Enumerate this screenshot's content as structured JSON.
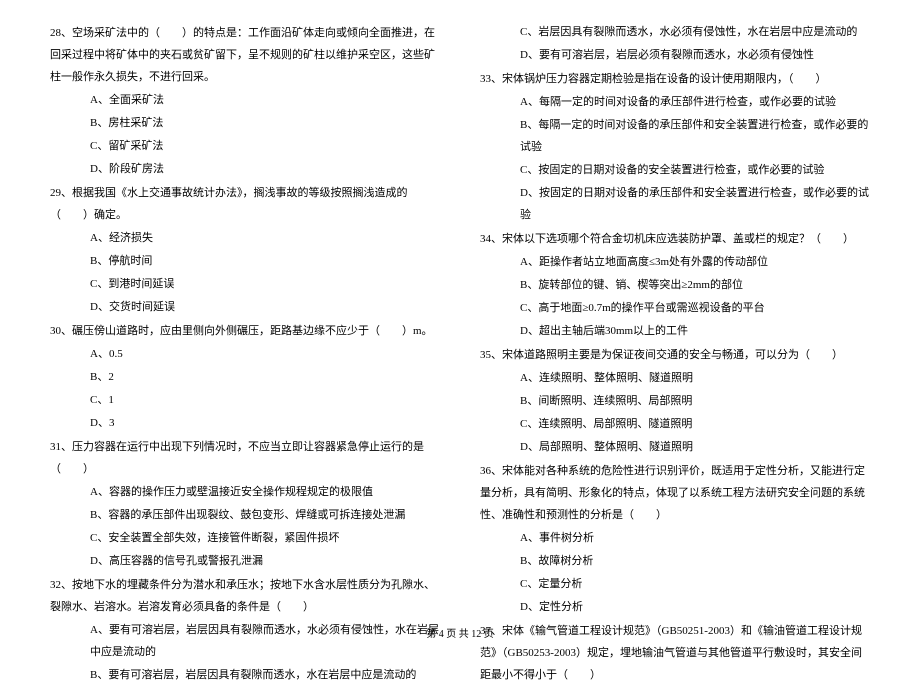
{
  "left_column": {
    "q28": {
      "text": "28、空场采矿法中的（　　）的特点是：工作面沿矿体走向或倾向全面推进，在回采过程中将矿体中的夹石或贫矿留下，呈不规则的矿柱以维护采空区，这些矿柱一般作永久损失，不进行回采。",
      "opts": [
        "A、全面采矿法",
        "B、房柱采矿法",
        "C、留矿采矿法",
        "D、阶段矿房法"
      ]
    },
    "q29": {
      "text": "29、根据我国《水上交通事故统计办法》，搁浅事故的等级按照搁浅造成的（　　）确定。",
      "opts": [
        "A、经济损失",
        "B、停航时间",
        "C、到港时间延误",
        "D、交货时间延误"
      ]
    },
    "q30": {
      "text": "30、碾压傍山道路时，应由里侧向外侧碾压，距路基边缘不应少于（　　）m。",
      "opts": [
        "A、0.5",
        "B、2",
        "C、1",
        "D、3"
      ]
    },
    "q31": {
      "text": "31、压力容器在运行中出现下列情况时，不应当立即让容器紧急停止运行的是（　　）",
      "opts": [
        "A、容器的操作压力或壁温接近安全操作规程规定的极限值",
        "B、容器的承压部件出现裂纹、鼓包变形、焊缝或可拆连接处泄漏",
        "C、安全装置全部失效，连接管件断裂，紧固件损坏",
        "D、高压容器的信号孔或警报孔泄漏"
      ]
    },
    "q32": {
      "text": "32、按地下水的埋藏条件分为潜水和承压水；按地下水含水层性质分为孔隙水、裂隙水、岩溶水。岩溶发育必须具备的条件是（　　）",
      "opts": [
        "A、要有可溶岩层，岩层因具有裂隙而透水，水必须有侵蚀性，水在岩层中应是流动的",
        "B、要有可溶岩层，岩层因具有裂隙而透水，水在岩层中应是流动的"
      ]
    }
  },
  "right_column": {
    "q32_cont": {
      "opts": [
        "C、岩层因具有裂隙而透水，水必须有侵蚀性，水在岩层中应是流动的",
        "D、要有可溶岩层，岩层必须有裂隙而透水，水必须有侵蚀性"
      ]
    },
    "q33": {
      "text": "33、宋体锅炉压力容器定期检验是指在设备的设计使用期限内，（　　）",
      "opts": [
        "A、每隔一定的时间对设备的承压部件进行检查，或作必要的试验",
        "B、每隔一定的时间对设备的承压部件和安全装置进行检查，或作必要的试验",
        "C、按固定的日期对设备的安全装置进行检查，或作必要的试验",
        "D、按固定的日期对设备的承压部件和安全装置进行检查，或作必要的试验"
      ]
    },
    "q34": {
      "text": "34、宋体以下选项哪个符合金切机床应选装防护罩、盖或栏的规定？（　　）",
      "opts": [
        "A、距操作者站立地面高度≤3m处有外露的传动部位",
        "B、旋转部位的键、销、楔等突出≥2mm的部位",
        "C、高于地面≥0.7m的操作平台或需巡视设备的平台",
        "D、超出主轴后端30mm以上的工件"
      ]
    },
    "q35": {
      "text": "35、宋体道路照明主要是为保证夜间交通的安全与畅通，可以分为（　　）",
      "opts": [
        "A、连续照明、整体照明、隧道照明",
        "B、间断照明、连续照明、局部照明",
        "C、连续照明、局部照明、隧道照明",
        "D、局部照明、整体照明、隧道照明"
      ]
    },
    "q36": {
      "text": "36、宋体能对各种系统的危险性进行识别评价，既适用于定性分析，又能进行定量分析，具有简明、形象化的特点，体现了以系统工程方法研究安全问题的系统性、准确性和预测性的分析是（　　）",
      "opts": [
        "A、事件树分析",
        "B、故障树分析",
        "C、定量分析",
        "D、定性分析"
      ]
    },
    "q37": {
      "text": "37、宋体《输气管道工程设计规范》（GB50251-2003）和《输油管道工程设计规范》（GB50253-2003）规定，埋地输油气管道与其他管道平行敷设时，其安全间距最小不得小于（　　）"
    }
  },
  "footer": "第 4 页 共 12 页"
}
